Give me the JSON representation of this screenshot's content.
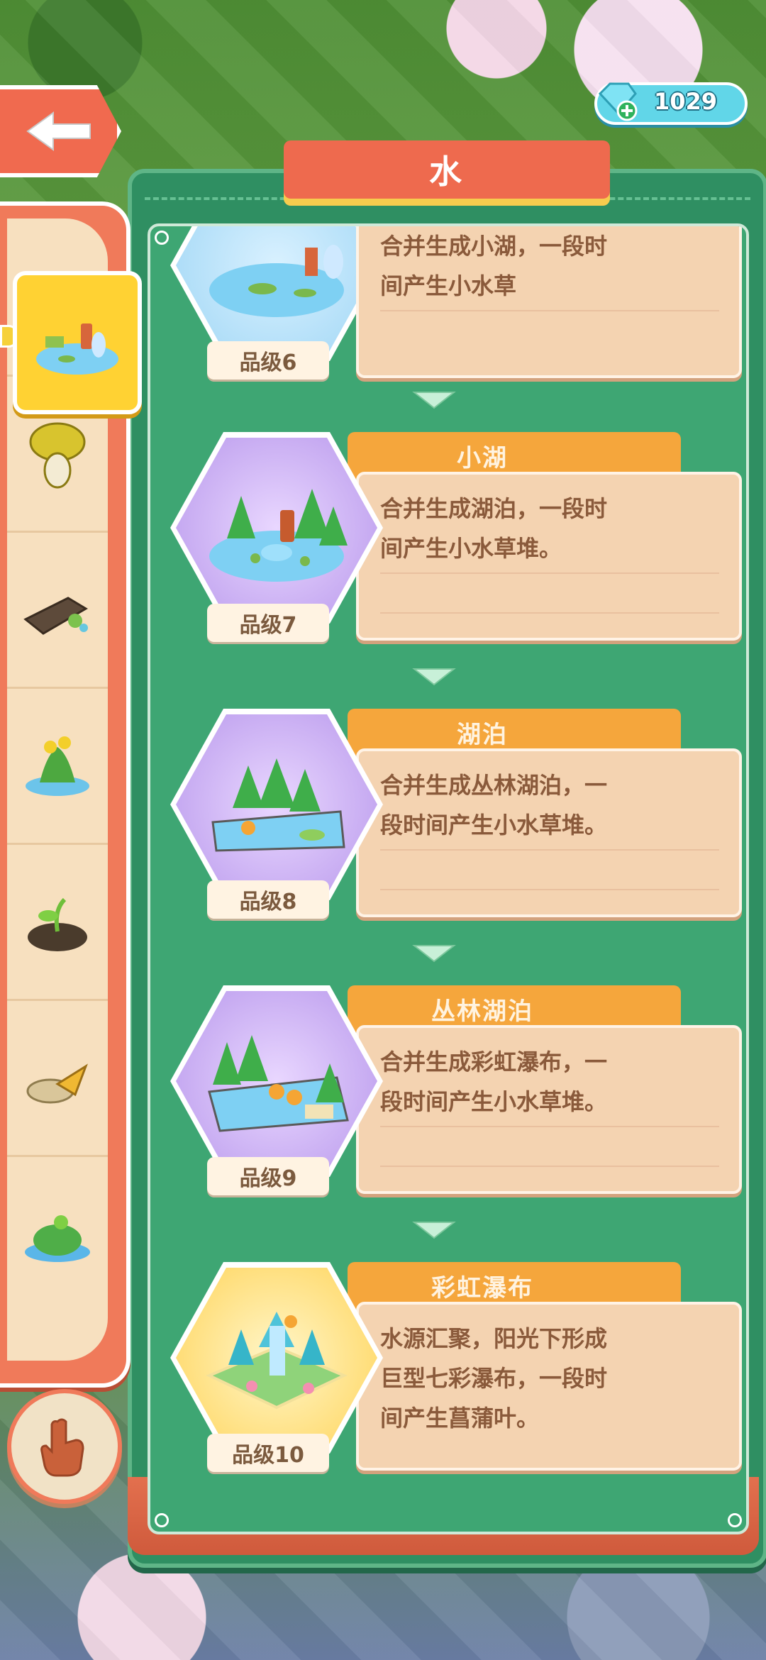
{
  "header": {
    "title": "水",
    "gem_count": "1029",
    "back_icon": "left-arrow-icon",
    "gem_icon": "diamond-plus-icon"
  },
  "sidebar": {
    "items": [
      {
        "icon": "pond-icon",
        "selected": true
      },
      {
        "icon": "mushroom-icon",
        "selected": false
      },
      {
        "icon": "log-icon",
        "selected": false
      },
      {
        "icon": "flower-pond-icon",
        "selected": false
      },
      {
        "icon": "sprout-icon",
        "selected": false
      },
      {
        "icon": "leaf-rock-icon",
        "selected": false
      },
      {
        "icon": "island-icon",
        "selected": false
      }
    ],
    "hand_icon": "hand-pointer-icon"
  },
  "items": [
    {
      "level": "品级6",
      "name": "",
      "desc_line1": "合并生成小湖，一段时",
      "desc_line2": "间产生小水草"
    },
    {
      "level": "品级7",
      "name": "小湖",
      "desc_line1": "合并生成湖泊，一段时",
      "desc_line2": "间产生小水草堆。"
    },
    {
      "level": "品级8",
      "name": "湖泊",
      "desc_line1": "合并生成丛林湖泊，一",
      "desc_line2": "段时间产生小水草堆。"
    },
    {
      "level": "品级9",
      "name": "丛林湖泊",
      "desc_line1": "合并生成彩虹瀑布，一",
      "desc_line2": "段时间产生小水草堆。"
    },
    {
      "level": "品级10",
      "name": "彩虹瀑布",
      "desc_line1": "水源汇聚，阳光下形成",
      "desc_line2": "巨型七彩瀑布，一段时",
      "desc_line3": "间产生菖蒲叶。"
    }
  ],
  "colors": {
    "panel_green": "#2f8f62",
    "title_red": "#ee6a4e",
    "tab_orange": "#f5a63c",
    "card_tan": "#f4d3b1",
    "selected_yellow": "#ffd233"
  }
}
